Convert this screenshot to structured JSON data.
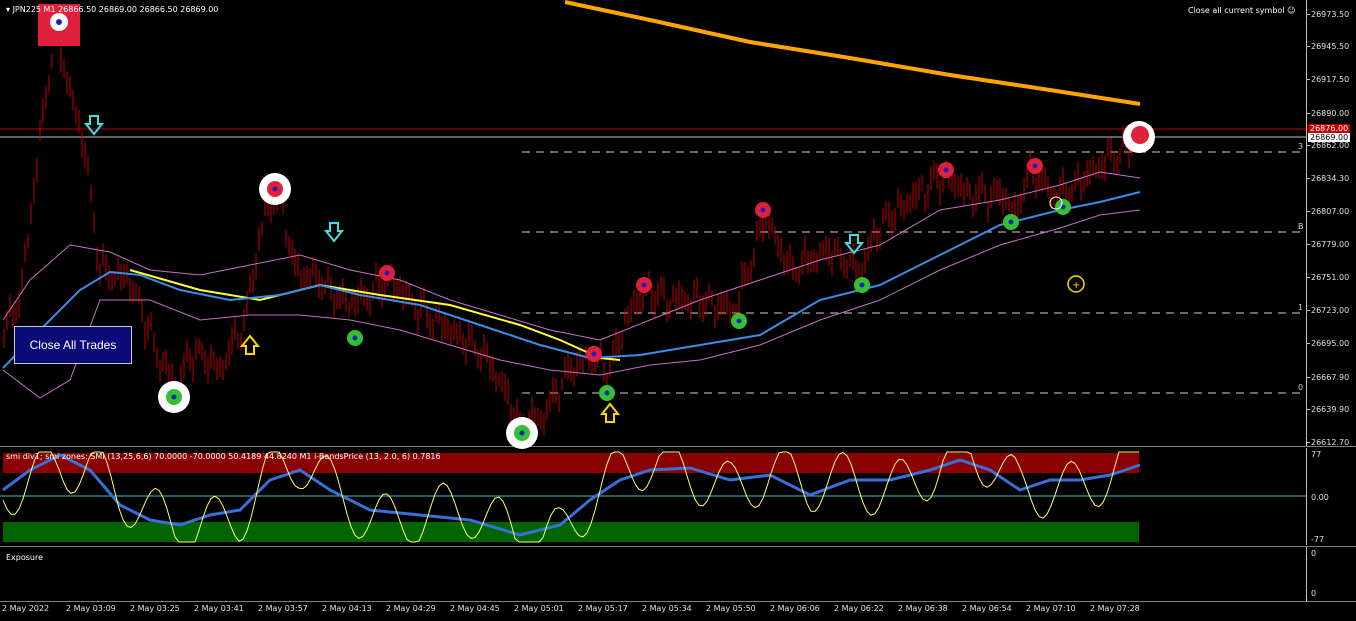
{
  "header": {
    "symbol_info": "JPN225 M1 26866.50 26869.00 26866.50 26869.00",
    "close_symbol_label": "Close all current symbol",
    "close_symbol_icon": "smiley-icon"
  },
  "buttons": {
    "close_all_trades": "Close All Trades"
  },
  "price_axis": {
    "ticks": [
      "26973.50",
      "26945.50",
      "26917.50",
      "26890.00",
      "26862.00",
      "26834.30",
      "26807.00",
      "26779.00",
      "26751.00",
      "26723.00",
      "26695.00",
      "26667.90",
      "26639.90",
      "26612.70"
    ],
    "ask_tag": "26876.00",
    "bid_tag": "26869.00"
  },
  "fib_labels": [
    "3",
    "B",
    "1",
    "0"
  ],
  "smi_panel": {
    "label": "smi div1; smi zones: SMI (13,25,6,6) 70.0000 -70.0000 50.4189 44.8240  M1 i-BandsPrice (13, 2.0, 6) 0.7816",
    "ticks": [
      "77",
      "0.00",
      "-77"
    ]
  },
  "exposure_panel": {
    "label": "Exposure",
    "ticks": [
      "0",
      "0"
    ]
  },
  "time_axis": {
    "ticks": [
      "2 May 2022",
      "2 May 03:09",
      "2 May 03:25",
      "2 May 03:41",
      "2 May 03:57",
      "2 May 04:13",
      "2 May 04:29",
      "2 May 04:45",
      "2 May 05:01",
      "2 May 05:17",
      "2 May 05:34",
      "2 May 05:50",
      "2 May 06:06",
      "2 May 06:22",
      "2 May 06:38",
      "2 May 06:54",
      "2 May 07:10",
      "2 May 07:28"
    ]
  },
  "colors": {
    "candle": "#c00000",
    "ma_slow": "#ffa500",
    "ma_mid": "#ffff33",
    "ma_fast": "#3a8ee6",
    "bands": "#c86ec8",
    "smi_line": "#3a6fd8",
    "smi_signal": "#ffff66",
    "smi_zero": "#40c0c0",
    "zone_high": "#8b0000",
    "zone_low": "#006400",
    "arrow_down": "#40e0e0",
    "arrow_up": "#ffd700"
  }
}
